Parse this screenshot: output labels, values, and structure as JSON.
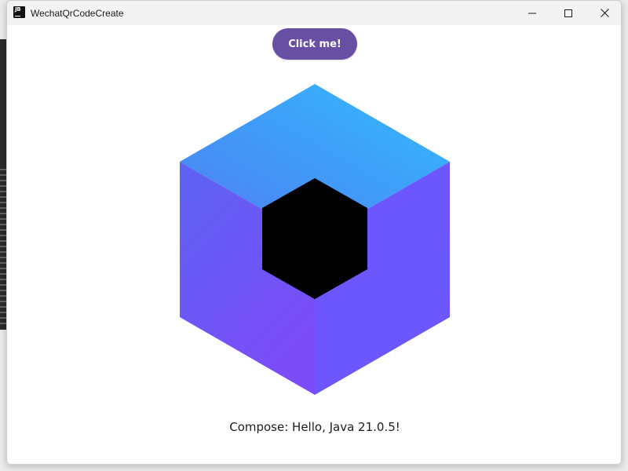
{
  "window": {
    "title": "WechatQrCodeCreate",
    "app_icon": "jetbrains-icon",
    "app_icon_text": "JB",
    "controls": {
      "minimize": "minimize-icon",
      "maximize": "maximize-icon",
      "close": "close-icon"
    }
  },
  "content": {
    "button_label": "Click me!",
    "greeting": "Compose: Hello, Java 21.0.5!",
    "logo": "compose-multiplatform-logo-icon"
  },
  "colors": {
    "button_bg": "#6750a4",
    "logo_top_start": "#3b8ef0",
    "logo_top_end": "#33bbff",
    "logo_left_start": "#5b6cf2",
    "logo_left_end": "#7a4cf7",
    "logo_right": "#6b57ff",
    "logo_center": "#000000"
  }
}
